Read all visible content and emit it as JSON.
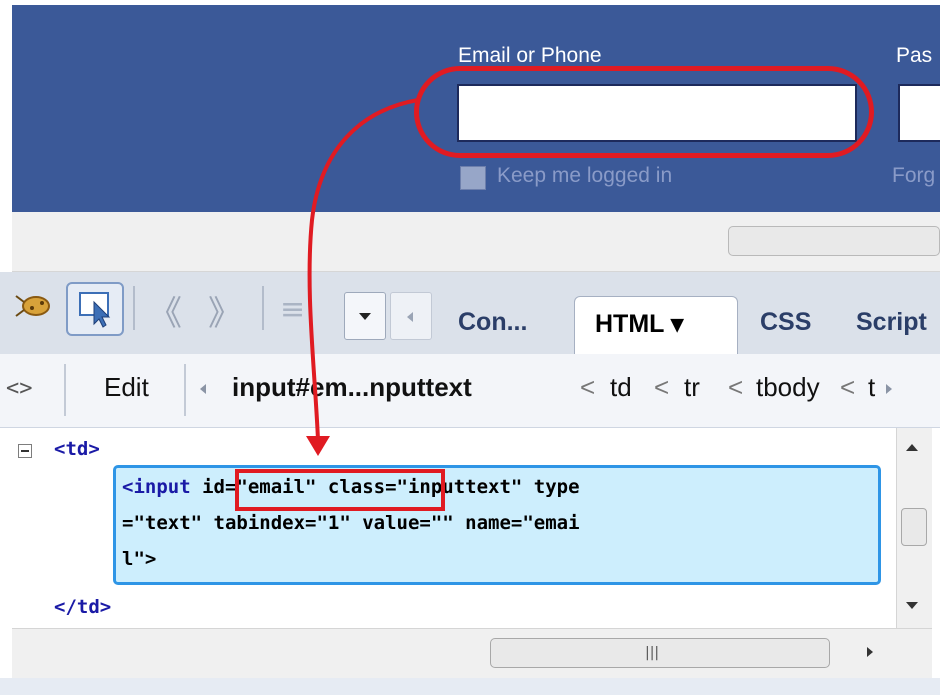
{
  "facebook": {
    "email_label": "Email or Phone",
    "password_label_partial": "Pas",
    "keep_logged_in": "Keep me logged in",
    "forgot_partial": "Forg",
    "email_value": ""
  },
  "toolbar": {
    "tabs": [
      "Con...",
      "HTML ▾",
      "CSS",
      "Script"
    ]
  },
  "breadcrumb": {
    "edit": "Edit",
    "current": "input#em...nputtext",
    "parents": [
      "td",
      "tr",
      "tbody",
      "t"
    ]
  },
  "html_panel": {
    "line1": "<td>",
    "line2a": "<input ",
    "line2b": "id=\"email\"",
    "line2c": " class=\"inputtext\" type",
    "line3": "=\"text\" tabindex=\"1\" value=\"\" name=\"emai",
    "line4": "l\">",
    "line5": "</td>"
  },
  "colors": {
    "facebook_blue": "#3b5998",
    "annotation_red": "#e01b22",
    "selection_blue": "#cdeefd"
  }
}
